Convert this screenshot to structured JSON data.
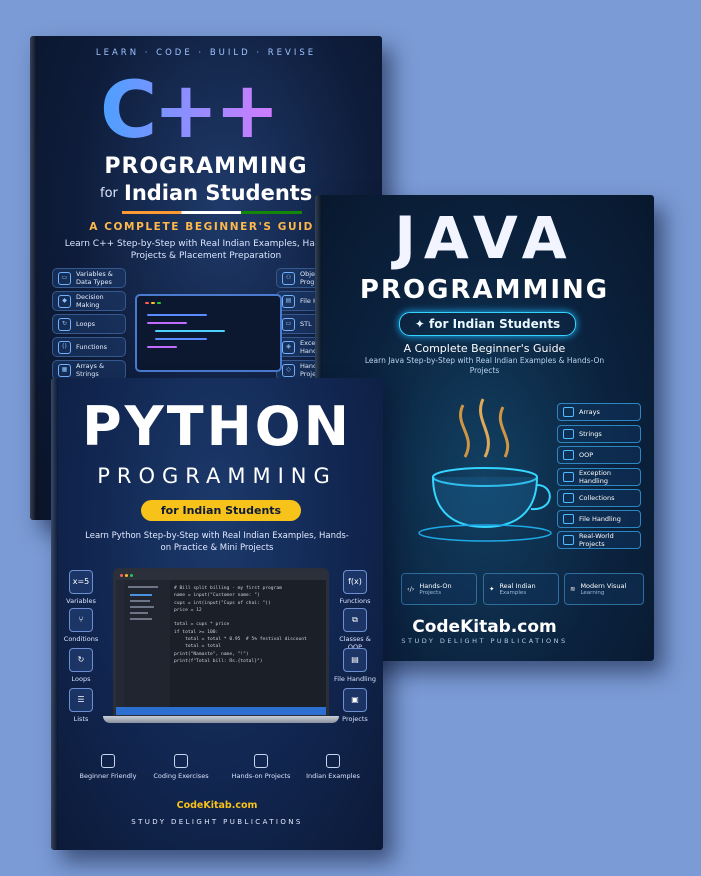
{
  "cpp": {
    "tagline": "LEARN · CODE · BUILD · REVISE",
    "logo": "C++",
    "programming": "PROGRAMMING",
    "for": "for",
    "indian": "Indian Students",
    "guide": "A COMPLETE BEGINNER'S GUIDE",
    "desc": "Learn C++ Step-by-Step with Real Indian Examples, Hands-On Projects & Placement Preparation",
    "left_topics": [
      "Variables & Data Types",
      "Decision Making",
      "Loops",
      "Functions",
      "Arrays & Strings"
    ],
    "right_topics": [
      "Object Program",
      "File Ha",
      "STL",
      "Excep Handl",
      "Handl Projec"
    ]
  },
  "java": {
    "title": "JAVA",
    "programming": "PROGRAMMING",
    "pill": "for Indian Students",
    "guide": "A Complete Beginner's Guide",
    "desc": "Learn Java Step-by-Step with Real Indian Examples & Hands-On Projects",
    "topics": [
      "Arrays",
      "Strings",
      "OOP",
      "Exception Handling",
      "Collections",
      "File Handling",
      "Real-World Projects"
    ],
    "features": [
      {
        "label": "Hands-On",
        "sub": "Projects"
      },
      {
        "label": "Real Indian",
        "sub": "Examples"
      },
      {
        "label": "Modern Visual",
        "sub": "Learning"
      }
    ],
    "site": "CodeKitab.com",
    "publisher": "STUDY DELIGHT PUBLICATIONS"
  },
  "python": {
    "title": "PYTHON",
    "programming": "PROGRAMMING",
    "pill": "for Indian Students",
    "desc": "Learn Python Step-by-Step with Real Indian Examples, Hands-on Practice & Mini Projects",
    "left_topics": [
      {
        "icon": "x=5",
        "label": "Variables"
      },
      {
        "icon": "⑂",
        "label": "Conditions"
      },
      {
        "icon": "↻",
        "label": "Loops"
      },
      {
        "icon": "☰",
        "label": "Lists"
      }
    ],
    "right_topics": [
      {
        "icon": "f(x)",
        "label": "Functions"
      },
      {
        "icon": "⧉",
        "label": "Classes & OOP"
      },
      {
        "icon": "▤",
        "label": "File Handling"
      },
      {
        "icon": "▣",
        "label": "Projects"
      }
    ],
    "code": "# Bill split billing - my first program\nname = input(\"Customer name: \")\ncups = int(input(\"Cups of chai: \"))\nprice = 12\n\ntotal = cups * price\nif total >= 100:\n    total = total * 0.95  # 5% festival discount\n    total = total\nprint(\"Namaste\", name, \"!\")\nprint(f\"Total bill: Rs.{total}\")",
    "features": [
      {
        "label": "Beginner Friendly"
      },
      {
        "label": "Coding Exercises"
      },
      {
        "label": "Hands-on Projects"
      },
      {
        "label": "Indian Examples"
      }
    ],
    "site": "CodeKitab.com",
    "publisher": "STUDY DELIGHT PUBLICATIONS"
  }
}
